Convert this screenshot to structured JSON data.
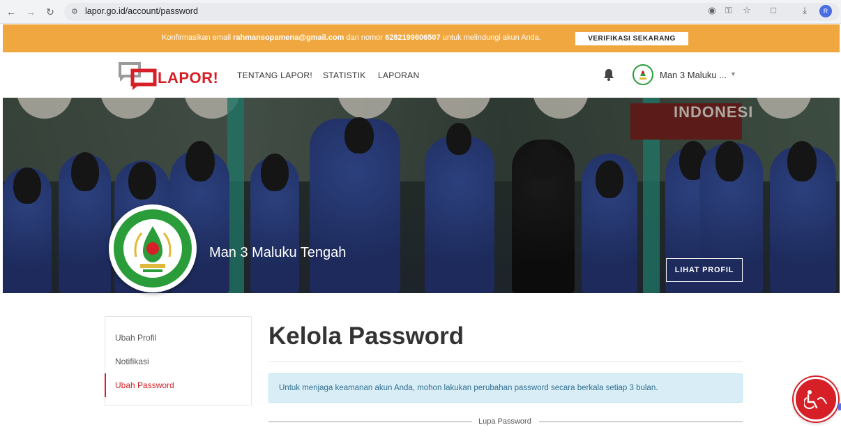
{
  "browser": {
    "url": "lapor.go.id/account/password",
    "profile_initial": "R"
  },
  "notice": {
    "prefix": "Konfirmasikan email ",
    "email": "rahmansopamena@gmail.com",
    "middle": " dan nomor ",
    "phone": "6282199606507",
    "suffix": " untuk melindungi akun Anda.",
    "button_label": "VERIFIKASI SEKARANG",
    "color": "#f1a73f"
  },
  "header": {
    "logo_text": "LAPOR!",
    "nav": [
      "TENTANG LAPOR!",
      "STATISTIK",
      "LAPORAN"
    ],
    "user_name": "Man 3 Maluku ...",
    "brand_color": "#d71f27"
  },
  "banner": {
    "sign_text": "INDONESI",
    "profile_name": "Man 3 Maluku Tengah",
    "profile_button": "LIHAT PROFIL"
  },
  "sidebar": {
    "items": [
      {
        "label": "Ubah Profil",
        "active": false
      },
      {
        "label": "Notifikasi",
        "active": false
      },
      {
        "label": "Ubah Password",
        "active": true
      }
    ]
  },
  "main": {
    "title": "Kelola Password",
    "info": "Untuk menjaga keamanan akun Anda, mohon lakukan perubahan password secara berkala setiap 3 bulan.",
    "section_divider": "Lupa Password"
  },
  "icons": {
    "back": "arrow-left-icon",
    "forward": "arrow-right-icon",
    "reload": "reload-icon",
    "site_info": "tune-icon",
    "location": "location-icon",
    "key": "key-icon",
    "star": "star-icon",
    "extensions": "puzzle-icon",
    "download": "download-icon",
    "bell": "bell-icon",
    "help": "accessibility-help-icon"
  }
}
